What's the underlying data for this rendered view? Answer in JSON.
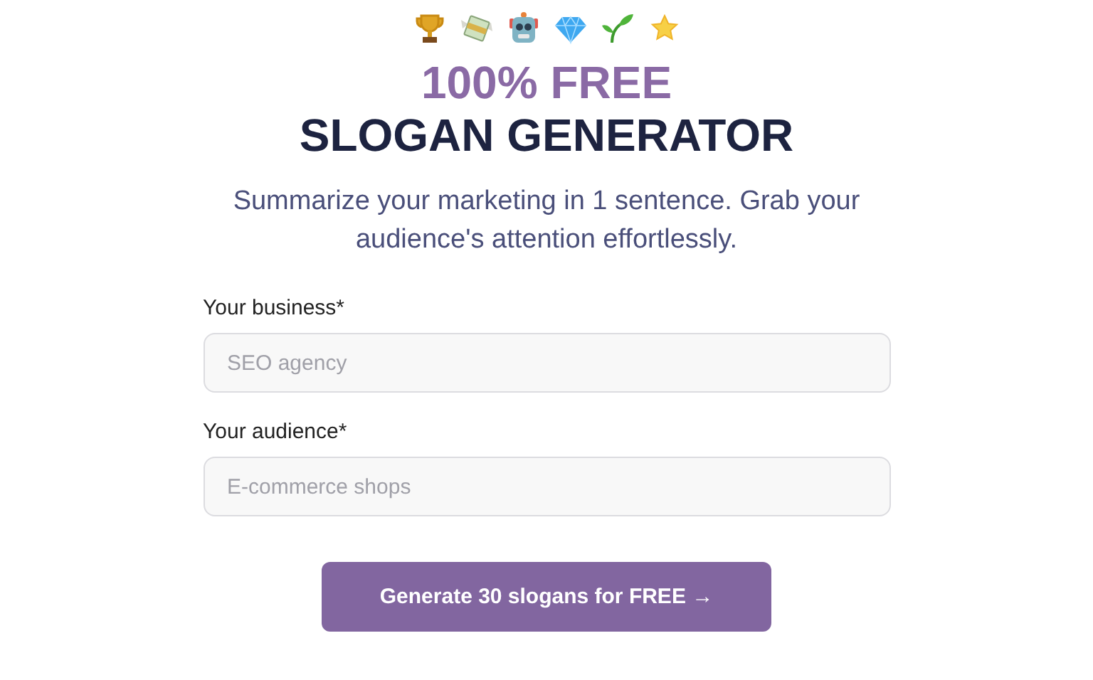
{
  "title_line_1": "100% FREE",
  "title_line_2": "SLOGAN GENERATOR",
  "subtitle": "Summarize your marketing in 1 sentence. Grab your audience's attention effortlessly.",
  "fields": [
    {
      "label": "Your business*",
      "placeholder": "SEO agency"
    },
    {
      "label": "Your audience*",
      "placeholder": "E-commerce shops"
    }
  ],
  "button": "Generate 30 slogans for FREE →"
}
